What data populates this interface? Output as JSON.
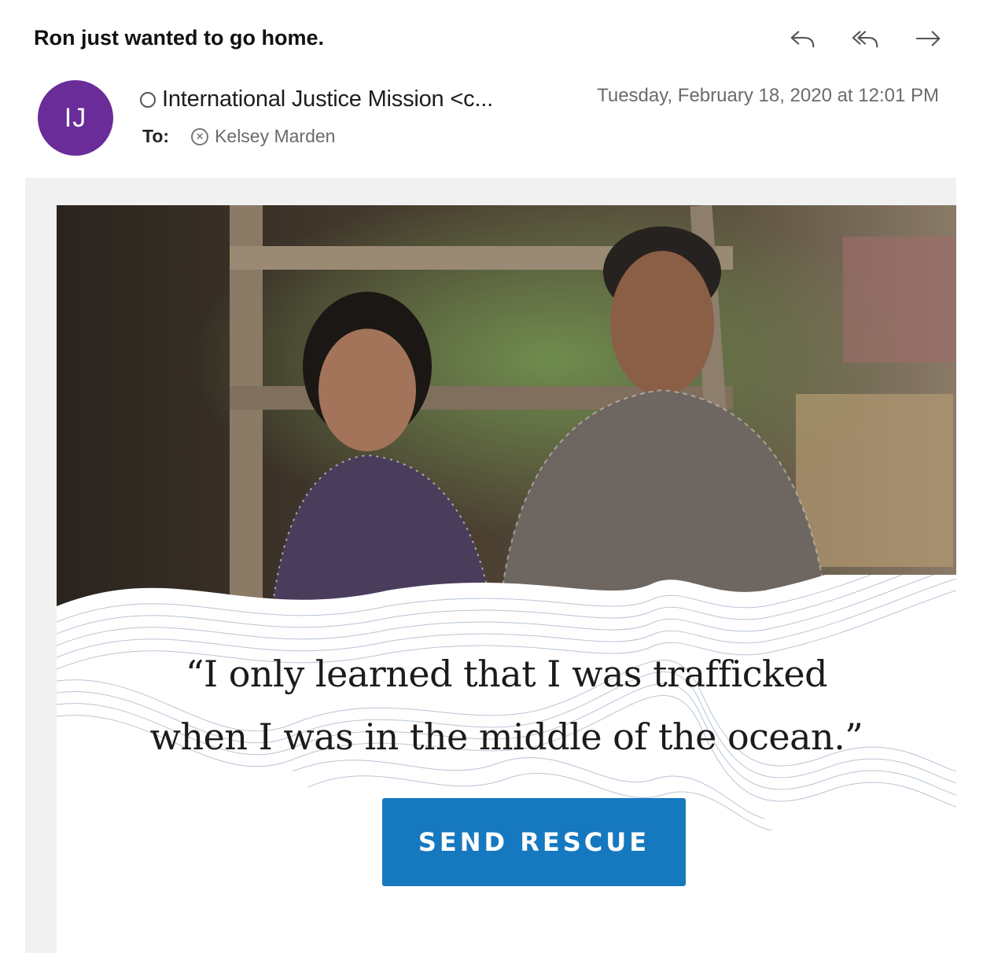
{
  "message": {
    "subject": "Ron just wanted to go home.",
    "avatar_initials": "IJ",
    "sender": "International Justice Mission <c...",
    "date": "Tuesday, February 18, 2020 at 12:01 PM",
    "to_label": "To:",
    "recipient": "Kelsey Marden"
  },
  "toolbar": {
    "reply_icon": "reply-icon",
    "reply_all_icon": "reply-all-icon",
    "forward_icon": "forward-icon"
  },
  "email_body": {
    "quote_line1": "“I only learned that I was trafficked",
    "quote_line2": "when I was in the middle of the ocean.”",
    "cta_label": "SEND RESCUE",
    "cta_color": "#1679c0"
  },
  "colors": {
    "avatar": "#6a2c99"
  }
}
